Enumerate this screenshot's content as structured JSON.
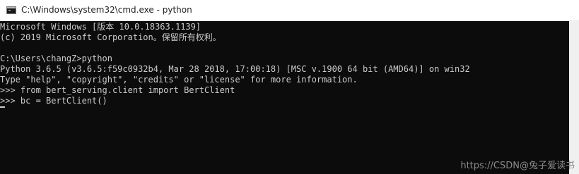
{
  "titlebar": {
    "icon": "cmd-icon",
    "title": "C:\\Windows\\system32\\cmd.exe - python"
  },
  "console": {
    "lines": [
      "Microsoft Windows [版本 10.0.18363.1139]",
      "(c) 2019 Microsoft Corporation。保留所有权利。",
      "",
      "C:\\Users\\changZ>python",
      "Python 3.6.5 (v3.6.5:f59c0932b4, Mar 28 2018, 17:00:18) [MSC v.1900 64 bit (AMD64)] on win32",
      "Type \"help\", \"copyright\", \"credits\" or \"license\" for more information.",
      ">>> from bert_serving.client import BertClient",
      ">>> bc = BertClient()"
    ]
  },
  "watermark": "https://CSDN@兔子爱读书"
}
